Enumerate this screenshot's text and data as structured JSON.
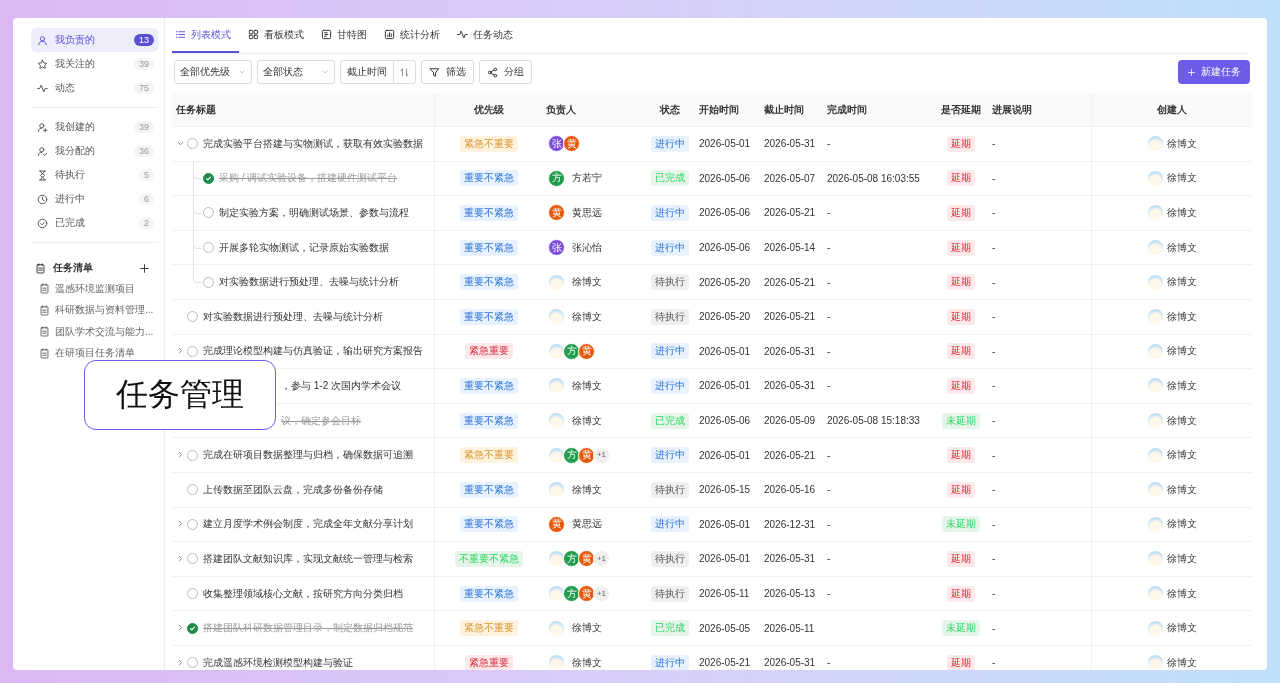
{
  "sidebar": {
    "groups": [
      {
        "items": [
          {
            "label": "我负责的",
            "count": "13",
            "selected": true
          },
          {
            "label": "我关注的",
            "count": "39",
            "selected": false
          },
          {
            "label": "动态",
            "count": "75",
            "selected": false
          }
        ]
      },
      {
        "items": [
          {
            "label": "我创建的",
            "count": "39",
            "selected": false
          },
          {
            "label": "我分配的",
            "count": "36",
            "selected": false
          },
          {
            "label": "待执行",
            "count": "5",
            "selected": false
          },
          {
            "label": "进行中",
            "count": "6",
            "selected": false
          },
          {
            "label": "已完成",
            "count": "2",
            "selected": false
          }
        ]
      }
    ],
    "task_lists": {
      "title": "任务清单",
      "items": [
        "遥感环境监测项目",
        "科研数据与资料管理...",
        "团队学术交流与能力...",
        "在研项目任务清单"
      ]
    }
  },
  "tabs": [
    {
      "label": "列表模式",
      "selected": true
    },
    {
      "label": "看板模式",
      "selected": false
    },
    {
      "label": "甘特图",
      "selected": false
    },
    {
      "label": "统计分析",
      "selected": false
    },
    {
      "label": "任务动态",
      "selected": false
    }
  ],
  "toolbar": {
    "filters": [
      "全部优先级",
      "全部状态"
    ],
    "sort": "截止时间",
    "buttons": [
      "筛选",
      "分组"
    ],
    "new_button": "新建任务"
  },
  "table": {
    "columns": [
      "任务标题",
      "优先级",
      "负责人",
      "状态",
      "开始时间",
      "截止时间",
      "完成时间",
      "是否延期",
      "进展说明",
      "创建人"
    ],
    "rows": [
      {
        "kind": "group",
        "expanded": true,
        "done": false,
        "title": "完成实验平台搭建与实物测试，获取有效实验数据",
        "priority": {
          "text": "紧急不重要",
          "color": "#fff3df"
        },
        "assignees": [
          {
            "kind": "letter",
            "letter": "张",
            "color": "#7c4ddb"
          },
          {
            "kind": "letter",
            "letter": "黄",
            "color": "#e8590c"
          }
        ],
        "status": {
          "text": "进行中",
          "color": "#e8f1fe"
        },
        "start": "2026-05-01",
        "due": "2026-05-31",
        "completed": "-",
        "delay": {
          "text": "延期",
          "color": "#fde8ea"
        },
        "progress": "-",
        "creator": "徐博文",
        "children": [
          {
            "done": true,
            "title": "采购 / 调试实验设备，搭建硬件测试平台",
            "priority": {
              "text": "重要不紧急",
              "color": "#e8f1fe"
            },
            "assignees": [
              {
                "kind": "letter",
                "letter": "方",
                "color": "#1f9d4c"
              }
            ],
            "assignee_name": "方若宁",
            "status": {
              "text": "已完成",
              "color": "#e5f5ea"
            },
            "start": "2026-05-06",
            "due": "2026-05-07",
            "completed": "2026-05-08 16:03:55",
            "delay": {
              "text": "延期",
              "color": "#fde8ea"
            },
            "progress": "-",
            "creator": "徐博文"
          },
          {
            "done": false,
            "title": "制定实验方案，明确测试场景、参数与流程",
            "priority": {
              "text": "重要不紧急",
              "color": "#e8f1fe"
            },
            "assignees": [
              {
                "kind": "letter",
                "letter": "黄",
                "color": "#e8590c"
              }
            ],
            "assignee_name": "黄思远",
            "status": {
              "text": "进行中",
              "color": "#e8f1fe"
            },
            "start": "2026-05-06",
            "due": "2026-05-21",
            "completed": "-",
            "delay": {
              "text": "延期",
              "color": "#fde8ea"
            },
            "progress": "-",
            "creator": "徐博文"
          },
          {
            "done": false,
            "title": "开展多轮实物测试，记录原始实验数据",
            "priority": {
              "text": "重要不紧急",
              "color": "#e8f1fe"
            },
            "assignees": [
              {
                "kind": "letter",
                "letter": "张",
                "color": "#7c4ddb"
              }
            ],
            "assignee_name": "张沁怡",
            "status": {
              "text": "进行中",
              "color": "#e8f1fe"
            },
            "start": "2026-05-06",
            "due": "2026-05-14",
            "completed": "-",
            "delay": {
              "text": "延期",
              "color": "#fde8ea"
            },
            "progress": "-",
            "creator": "徐博文"
          },
          {
            "done": false,
            "title": "对实验数据进行预处理、去噪与统计分析",
            "priority": {
              "text": "重要不紧急",
              "color": "#e8f1fe"
            },
            "assignees": [
              {
                "kind": "photo"
              }
            ],
            "assignee_name": "徐博文",
            "status": {
              "text": "待执行",
              "color": "#efefef"
            },
            "start": "2026-05-20",
            "due": "2026-05-21",
            "completed": "-",
            "delay": {
              "text": "延期",
              "color": "#fde8ea"
            },
            "progress": "-",
            "creator": "徐博文"
          }
        ]
      },
      {
        "kind": "task",
        "done": false,
        "title": "对实验数据进行预处理、去噪与统计分析",
        "priority": {
          "text": "重要不紧急",
          "color": "#e8f1fe"
        },
        "assignees": [
          {
            "kind": "photo"
          }
        ],
        "assignee_name": "徐博文",
        "status": {
          "text": "待执行",
          "color": "#efefef"
        },
        "start": "2026-05-20",
        "due": "2026-05-21",
        "completed": "-",
        "delay": {
          "text": "延期",
          "color": "#fde8ea"
        },
        "progress": "-",
        "creator": "徐博文"
      },
      {
        "kind": "group",
        "expanded": false,
        "done": false,
        "title": "完成理论模型构建与仿真验证，输出研究方案报告",
        "priority": {
          "text": "紧急重要",
          "color": "#fde8ea"
        },
        "assignees": [
          {
            "kind": "photo"
          },
          {
            "kind": "letter",
            "letter": "方",
            "color": "#1f9d4c"
          },
          {
            "kind": "letter",
            "letter": "黄",
            "color": "#e8590c"
          }
        ],
        "status": {
          "text": "进行中",
          "color": "#e8f1fe"
        },
        "start": "2026-05-01",
        "due": "2026-05-31",
        "completed": "-",
        "delay": {
          "text": "延期",
          "color": "#fde8ea"
        },
        "progress": "-",
        "creator": "徐博文"
      },
      {
        "kind": "covered",
        "done": false,
        "title": "，参与 1-2 次国内学术会议",
        "priority": {
          "text": "重要不紧急",
          "color": "#e8f1fe"
        },
        "assignees": [
          {
            "kind": "photo"
          }
        ],
        "assignee_name": "徐博文",
        "status": {
          "text": "进行中",
          "color": "#e8f1fe"
        },
        "start": "2026-05-01",
        "due": "2026-05-31",
        "completed": "-",
        "delay": {
          "text": "延期",
          "color": "#fde8ea"
        },
        "progress": "-",
        "creator": "徐博文"
      },
      {
        "kind": "covered",
        "done": true,
        "title": "议，确定参会目标",
        "priority": {
          "text": "重要不紧急",
          "color": "#e8f1fe"
        },
        "assignees": [
          {
            "kind": "photo"
          }
        ],
        "assignee_name": "徐博文",
        "status": {
          "text": "已完成",
          "color": "#e5f5ea"
        },
        "start": "2026-05-06",
        "due": "2026-05-09",
        "completed": "2026-05-08 15:18:33",
        "delay": {
          "text": "未延期",
          "color": "#e5f5ea"
        },
        "progress": "-",
        "creator": "徐博文"
      },
      {
        "kind": "group",
        "expanded": false,
        "done": false,
        "title": "完成在研项目数据整理与归档，确保数据可追溯",
        "priority": {
          "text": "紧急不重要",
          "color": "#fff3df"
        },
        "assignees": [
          {
            "kind": "photo"
          },
          {
            "kind": "letter",
            "letter": "方",
            "color": "#1f9d4c"
          },
          {
            "kind": "letter",
            "letter": "黄",
            "color": "#e8590c"
          }
        ],
        "more": "+1",
        "status": {
          "text": "进行中",
          "color": "#e8f1fe"
        },
        "start": "2026-05-01",
        "due": "2026-05-21",
        "completed": "-",
        "delay": {
          "text": "延期",
          "color": "#fde8ea"
        },
        "progress": "-",
        "creator": "徐博文"
      },
      {
        "kind": "task",
        "done": false,
        "title": "上传数据至团队云盘，完成多份备份存储",
        "priority": {
          "text": "重要不紧急",
          "color": "#e8f1fe"
        },
        "assignees": [
          {
            "kind": "photo"
          }
        ],
        "assignee_name": "徐博文",
        "status": {
          "text": "待执行",
          "color": "#efefef"
        },
        "start": "2026-05-15",
        "due": "2026-05-16",
        "completed": "-",
        "delay": {
          "text": "延期",
          "color": "#fde8ea"
        },
        "progress": "-",
        "creator": "徐博文"
      },
      {
        "kind": "group",
        "expanded": false,
        "done": false,
        "title": "建立月度学术例会制度，完成全年文献分享计划",
        "priority": {
          "text": "重要不紧急",
          "color": "#e8f1fe"
        },
        "assignees": [
          {
            "kind": "letter",
            "letter": "黄",
            "color": "#e8590c"
          }
        ],
        "assignee_name": "黄思远",
        "status": {
          "text": "进行中",
          "color": "#e8f1fe"
        },
        "start": "2026-05-01",
        "due": "2026-12-31",
        "completed": "-",
        "delay": {
          "text": "未延期",
          "color": "#e5f5ea"
        },
        "progress": "-",
        "creator": "徐博文"
      },
      {
        "kind": "group",
        "expanded": false,
        "done": false,
        "title": "搭建团队文献知识库，实现文献统一管理与检索",
        "priority": {
          "text": "不重要不紧急",
          "color": "#e5f5ea"
        },
        "assignees": [
          {
            "kind": "photo"
          },
          {
            "kind": "letter",
            "letter": "方",
            "color": "#1f9d4c"
          },
          {
            "kind": "letter",
            "letter": "黄",
            "color": "#e8590c"
          }
        ],
        "more": "+1",
        "status": {
          "text": "待执行",
          "color": "#efefef"
        },
        "start": "2026-05-01",
        "due": "2026-05-31",
        "completed": "-",
        "delay": {
          "text": "延期",
          "color": "#fde8ea"
        },
        "progress": "-",
        "creator": "徐博文"
      },
      {
        "kind": "task",
        "done": false,
        "title": "收集整理领域核心文献，按研究方向分类归档",
        "priority": {
          "text": "重要不紧急",
          "color": "#e8f1fe"
        },
        "assignees": [
          {
            "kind": "photo"
          },
          {
            "kind": "letter",
            "letter": "方",
            "color": "#1f9d4c"
          },
          {
            "kind": "letter",
            "letter": "黄",
            "color": "#e8590c"
          }
        ],
        "more": "+1",
        "status": {
          "text": "待执行",
          "color": "#efefef"
        },
        "start": "2026-05-11",
        "due": "2026-05-13",
        "completed": "-",
        "delay": {
          "text": "延期",
          "color": "#fde8ea"
        },
        "progress": "-",
        "creator": "徐博文"
      },
      {
        "kind": "group",
        "expanded": false,
        "done": true,
        "title": "搭建团队科研数据管理目录，制定数据归档规范",
        "priority": {
          "text": "紧急不重要",
          "color": "#fff3df"
        },
        "assignees": [
          {
            "kind": "photo"
          }
        ],
        "assignee_name": "徐博文",
        "status": {
          "text": "已完成",
          "color": "#e5f5ea"
        },
        "start": "2026-05-05",
        "due": "2026-05-11",
        "delay": {
          "text": "未延期",
          "color": "#e5f5ea"
        },
        "progress": "-",
        "creator": "徐博文"
      },
      {
        "kind": "group",
        "expanded": false,
        "done": false,
        "title": "完成遥感环境检测模型构建与验证",
        "priority": {
          "text": "紧急重要",
          "color": "#fde8ea"
        },
        "assignees": [
          {
            "kind": "photo"
          }
        ],
        "assignee_name": "徐博文",
        "status": {
          "text": "进行中",
          "color": "#e8f1fe"
        },
        "start": "2026-05-21",
        "due": "2026-05-31",
        "completed": "-",
        "delay": {
          "text": "延期",
          "color": "#fde8ea"
        },
        "progress": "-",
        "creator": "徐博文"
      }
    ]
  },
  "callout": "任务管理"
}
